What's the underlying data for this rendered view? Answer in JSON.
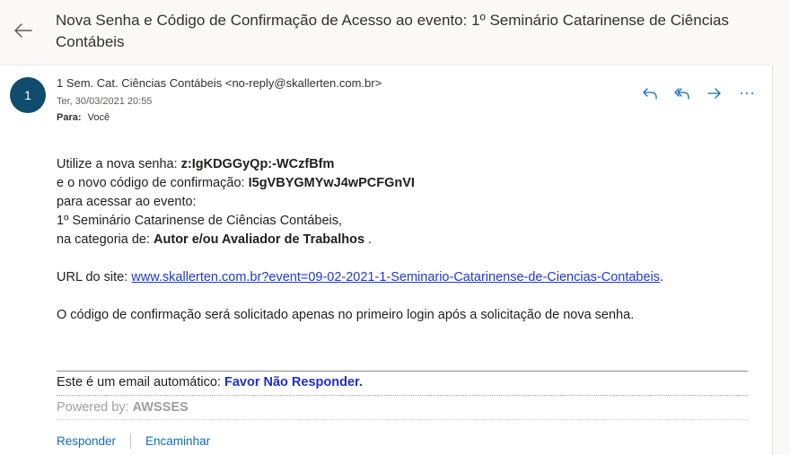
{
  "email": {
    "subject": "Nova Senha e Código de Confirmação de Acesso ao evento: 1º Seminário Catarinense de Ciências Contábeis",
    "avatar_initial": "1",
    "sender": "1 Sem. Cat. Ciências Contábeis <no-reply@skallerten.com.br>",
    "date": "Ter, 30/03/2021 20:55",
    "to_label": "Para:",
    "to_value": "Você"
  },
  "body": {
    "line1_prefix": "Utilize a nova senha: ",
    "password": "z:IgKDGGyQp:-WCzfBfm",
    "line2_prefix": "e o novo código de confirmação: ",
    "code": "I5gVBYGMYwJ4wPCFGnVI",
    "line3": "para acessar ao evento:",
    "line4": "1º Seminário Catarinense de Ciências Contábeis,",
    "line5_prefix": "na categoria de: ",
    "category": "Autor e/ou Avaliador de Trabalhos",
    "line5_suffix": " .",
    "url_prefix": "URL do site: ",
    "url": "www.skallerten.com.br?event=09-02-2021-1-Seminario-Catarinense-de-Ciencias-Contabeis",
    "url_suffix": ".",
    "note": "O código de confirmação será solicitado apenas no primeiro login após a solicitação de nova senha."
  },
  "footer": {
    "auto_prefix": "Este é um email automático: ",
    "auto_emphasis": "Favor Não Responder.",
    "powered_prefix": "Powered by: ",
    "powered_brand": "AWSSES"
  },
  "actions": {
    "reply": "Responder",
    "forward": "Encaminhar"
  },
  "icons": {
    "back": "back-arrow-icon",
    "reply": "reply-icon",
    "reply_all": "reply-all-icon",
    "forward": "forward-icon",
    "more": "more-icon"
  },
  "colors": {
    "avatar": "#0f4c6e",
    "action_blue": "#0f6cbd",
    "link_blue": "#1f3ad6"
  }
}
